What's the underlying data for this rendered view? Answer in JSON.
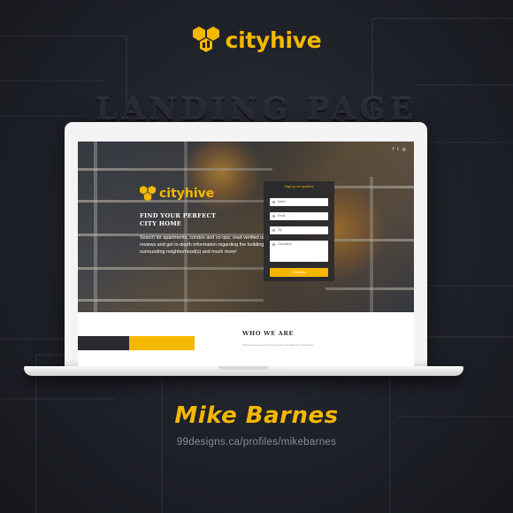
{
  "branding": {
    "logo_text": "cityhive",
    "brand_color": "#f5b800"
  },
  "heading": "LANDING PAGE",
  "hero": {
    "social_icons": [
      "facebook-icon",
      "twitter-icon",
      "instagram-icon"
    ],
    "social_glyphs": [
      "f",
      "t",
      "◎"
    ],
    "logo_text": "cityhive",
    "tagline_line1": "FIND YOUR PERFECT",
    "tagline_line2": "CITY HOME",
    "description": "Search for apartments, condos and co-ops; read verified user reviews and get in-depth information regarding the building, surrounding neighborhood(s) and much more!"
  },
  "signup": {
    "title": "Sign up for updates",
    "fields": [
      "Name",
      "Email",
      "Zip",
      "Comments"
    ],
    "submit": "Subscribe"
  },
  "section": {
    "title": "WHO WE ARE",
    "text": "Cityhive users can rent and buy in a the surrounding city in depth and"
  },
  "designer": {
    "name": "Mike Barnes",
    "url": "99designs.ca/profiles/mikebarnes"
  }
}
